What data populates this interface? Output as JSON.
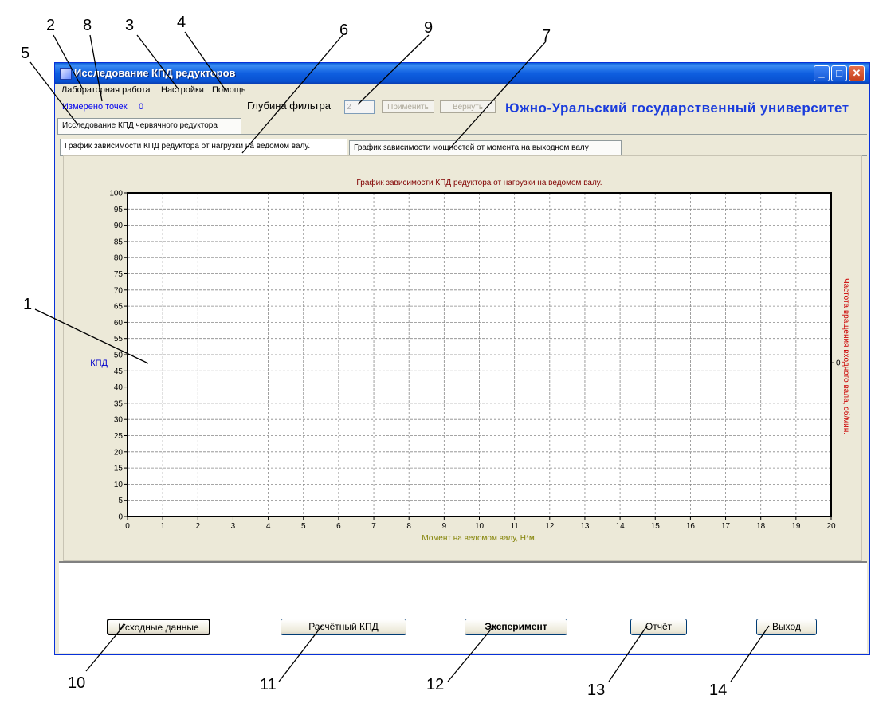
{
  "window": {
    "title": "Исследование КПД редукторов",
    "controls": {
      "minimize": "_",
      "maximize": "□",
      "close": "✕"
    }
  },
  "menu": [
    "Лабораторная работа",
    "Настройки",
    "Помощь"
  ],
  "info": {
    "measured_label": "Измерено точек",
    "measured_value": "0",
    "filter_label": "Глубина фильтра",
    "filter_value": "2",
    "apply_label": "Применить",
    "revert_label": "Вернуть",
    "university": "Южно-Уральский  государственный  университет"
  },
  "top_tab": "Исследование КПД червячного редуктора",
  "chart_tabs": [
    "График зависимости КПД редуктора от нагрузки на ведомом валу.",
    "График зависимости мощностей от момента на выходном валу"
  ],
  "buttons": {
    "initial_data": "Исходные данные",
    "calc_efficiency": "Расчётный КПД",
    "experiment": "Эксперимент",
    "report": "Отчёт",
    "exit": "Выход"
  },
  "callouts": [
    "1",
    "2",
    "3",
    "4",
    "5",
    "6",
    "7",
    "8",
    "9",
    "10",
    "11",
    "12",
    "13",
    "14"
  ],
  "colors": {
    "title": "#800000",
    "ylabel": "#0000cc",
    "xlabel": "#808000",
    "y2label": "#cc0000",
    "university": "#1a3cdc"
  },
  "chart_data": {
    "type": "line",
    "title": "График зависимости КПД редуктора от нагрузки на ведомом валу.",
    "xlabel": "Момент на ведомом валу, Н*м.",
    "ylabel": "КПД",
    "y2label": "Частота вращения входного вала, об/мин.",
    "xlim": [
      0,
      20
    ],
    "ylim": [
      0,
      100
    ],
    "xticks": [
      "0",
      "1",
      "2",
      "3",
      "4",
      "5",
      "6",
      "7",
      "8",
      "9",
      "10",
      "11",
      "12",
      "13",
      "14",
      "15",
      "16",
      "17",
      "18",
      "19",
      "20"
    ],
    "yticks": [
      "0",
      "5",
      "10",
      "15",
      "20",
      "25",
      "30",
      "35",
      "40",
      "45",
      "50",
      "55",
      "60",
      "65",
      "70",
      "75",
      "80",
      "85",
      "90",
      "95",
      "100"
    ],
    "y2ticks": [
      "0"
    ],
    "grid": true,
    "series": []
  }
}
